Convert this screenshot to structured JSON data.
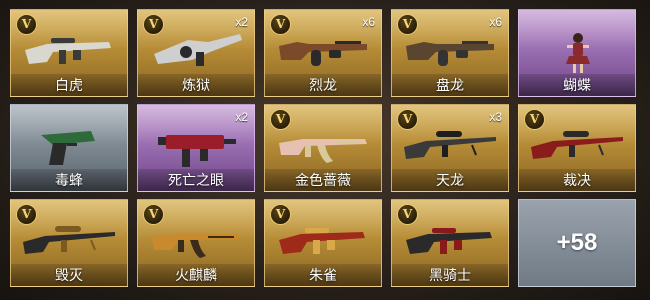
{
  "items": [
    {
      "name": "白虎",
      "count": "",
      "rarity": "gold",
      "badge": "V",
      "art": "rifle",
      "c1": "#d8d8d0",
      "c2": "#3a3a3a"
    },
    {
      "name": "炼狱",
      "count": "x2",
      "rarity": "gold",
      "badge": "V",
      "art": "gatling",
      "c1": "#cfcfcf",
      "c2": "#2a2a2a"
    },
    {
      "name": "烈龙",
      "count": "x6",
      "rarity": "gold",
      "badge": "V",
      "art": "thompson",
      "c1": "#7a4a2a",
      "c2": "#2a2a2a"
    },
    {
      "name": "盘龙",
      "count": "x6",
      "rarity": "gold",
      "badge": "V",
      "art": "thompson",
      "c1": "#5a4630",
      "c2": "#333333"
    },
    {
      "name": "蝴蝶",
      "count": "",
      "rarity": "purple",
      "badge": "",
      "art": "character",
      "c1": "#8b2a2a",
      "c2": "#2a1a1a"
    },
    {
      "name": "毒蜂",
      "count": "",
      "rarity": "silver",
      "badge": "",
      "art": "pistol",
      "c1": "#2e6a3a",
      "c2": "#2a2a2a"
    },
    {
      "name": "死亡之眼",
      "count": "x2",
      "rarity": "purple",
      "badge": "",
      "art": "smg",
      "c1": "#9a1e2a",
      "c2": "#2a2a2a"
    },
    {
      "name": "金色蔷薇",
      "count": "",
      "rarity": "gold",
      "badge": "V",
      "art": "ak",
      "c1": "#e6c0b0",
      "c2": "#d8c89a"
    },
    {
      "name": "天龙",
      "count": "x3",
      "rarity": "gold",
      "badge": "V",
      "art": "sniper",
      "c1": "#3a3a3a",
      "c2": "#1e1e1e"
    },
    {
      "name": "裁决",
      "count": "",
      "rarity": "gold",
      "badge": "V",
      "art": "sniper",
      "c1": "#8a1c1c",
      "c2": "#2a2a2a"
    },
    {
      "name": "毁灭",
      "count": "",
      "rarity": "gold",
      "badge": "V",
      "art": "sniper",
      "c1": "#2a2a2a",
      "c2": "#7a5a20"
    },
    {
      "name": "火麒麟",
      "count": "",
      "rarity": "gold",
      "badge": "V",
      "art": "ak",
      "c1": "#c88a2a",
      "c2": "#3a2a1a"
    },
    {
      "name": "朱雀",
      "count": "",
      "rarity": "gold",
      "badge": "V",
      "art": "rifle",
      "c1": "#a02a1a",
      "c2": "#d8a84a"
    },
    {
      "name": "黑骑士",
      "count": "",
      "rarity": "gold",
      "badge": "V",
      "art": "rifle",
      "c1": "#2a2a2a",
      "c2": "#8a1a1a"
    }
  ],
  "more_label": "+58"
}
